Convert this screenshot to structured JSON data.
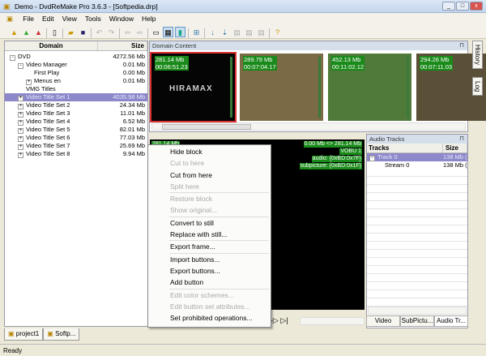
{
  "window": {
    "title": "Demo - DvdReMake Pro 3.6.3 - [Softpedia.drp]"
  },
  "menu": [
    "File",
    "Edit",
    "View",
    "Tools",
    "Window",
    "Help"
  ],
  "tree": {
    "headers": {
      "domain": "Domain",
      "size": "Size"
    },
    "rows": [
      {
        "label": "DVD",
        "size": "4272.56 Mb",
        "indent": 0,
        "exp": "-"
      },
      {
        "label": "Video Manager",
        "size": "0.01 Mb",
        "indent": 1,
        "exp": "-"
      },
      {
        "label": "First Play",
        "size": "0.00 Mb",
        "indent": 3,
        "exp": ""
      },
      {
        "label": "Menus en",
        "size": "0.01 Mb",
        "indent": 2,
        "exp": "+"
      },
      {
        "label": "VMG Titles",
        "size": "",
        "indent": 2,
        "exp": ""
      },
      {
        "label": "Video Title Set 1",
        "size": "4035.98 Mb",
        "indent": 1,
        "exp": "+",
        "selected": true
      },
      {
        "label": "Video Title Set 2",
        "size": "24.34 Mb",
        "indent": 1,
        "exp": "+"
      },
      {
        "label": "Video Title Set 3",
        "size": "11.01 Mb",
        "indent": 1,
        "exp": "+"
      },
      {
        "label": "Video Title Set 4",
        "size": "6.52 Mb",
        "indent": 1,
        "exp": "+"
      },
      {
        "label": "Video Title Set 5",
        "size": "82.01 Mb",
        "indent": 1,
        "exp": "+"
      },
      {
        "label": "Video Title Set 6",
        "size": "77.03 Mb",
        "indent": 1,
        "exp": "+"
      },
      {
        "label": "Video Title Set 7",
        "size": "25.69 Mb",
        "indent": 1,
        "exp": "+"
      },
      {
        "label": "Video Title Set 8",
        "size": "9.94 Mb",
        "indent": 1,
        "exp": "+"
      }
    ]
  },
  "project_tabs": [
    "project1",
    "Softp..."
  ],
  "status": "Ready",
  "domain_content": {
    "title": "Domain Content",
    "thumbs": [
      {
        "size": "281.14 Mb",
        "time": "00:06:51.23",
        "color": "#050505",
        "logo": "HIRAMAX"
      },
      {
        "size": "289.79 Mb",
        "time": "00:07:04.17",
        "color": "#7a6a45"
      },
      {
        "size": "452.13 Mb",
        "time": "00:11:02.12",
        "color": "#4f7a3a"
      },
      {
        "size": "294.26 Mb",
        "time": "00:07:11.03",
        "color": "#5a5038"
      }
    ]
  },
  "side_tabs": [
    "History",
    "Log"
  ],
  "preview": {
    "corner": "281.14 Mb",
    "range": "0.00 Mb <> 281.14 Mb",
    "vobu": "VOBU 1",
    "audio": "audio: {0xBD:0x7F}",
    "subpicture": "subpicture: {0xBD:0x1F}"
  },
  "audio_tracks": {
    "title": "Audio Tracks",
    "headers": {
      "tracks": "Tracks",
      "size": "Size"
    },
    "rows": [
      {
        "label": "Track 0",
        "size": "138 Mb (",
        "selected": true
      },
      {
        "label": "Stream 0",
        "size": "138 Mb ("
      }
    ],
    "tabs": [
      "Video",
      "SubPictu...",
      "Audio Tr..."
    ]
  },
  "context_menu": [
    {
      "label": "Hide block",
      "enabled": true
    },
    {
      "label": "Cut to here",
      "enabled": false
    },
    {
      "label": "Cut from here",
      "enabled": true
    },
    {
      "label": "Split here",
      "enabled": false,
      "sep": true
    },
    {
      "label": "Restore block",
      "enabled": false
    },
    {
      "label": "Show original...",
      "enabled": false,
      "sep": true
    },
    {
      "label": "Convert to still",
      "enabled": true
    },
    {
      "label": "Replace with still...",
      "enabled": true,
      "sep": true
    },
    {
      "label": "Export frame...",
      "enabled": true,
      "sep": true
    },
    {
      "label": "Import buttons...",
      "enabled": true
    },
    {
      "label": "Export buttons...",
      "enabled": true
    },
    {
      "label": "Add button",
      "enabled": true,
      "sep": true
    },
    {
      "label": "Edit color schemes...",
      "enabled": false
    },
    {
      "label": "Edit button set attributes...",
      "enabled": false
    },
    {
      "label": "Set prohibited operations...",
      "enabled": true
    }
  ]
}
